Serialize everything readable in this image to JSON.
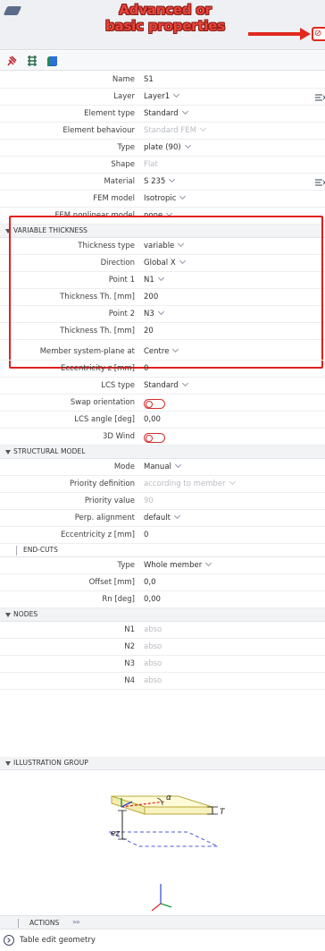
{
  "annotation": {
    "line1": "Advanced or",
    "line2": "basic properties",
    "color": "#e8443a"
  },
  "toolbar": {
    "icons": [
      "pin-icon",
      "layers-icon",
      "cube-icon"
    ]
  },
  "properties": {
    "name": {
      "label": "Name",
      "value": "S1"
    },
    "layer": {
      "label": "Layer",
      "value": "Layer1"
    },
    "element_type": {
      "label": "Element type",
      "value": "Standard"
    },
    "element_behaviour": {
      "label": "Element behaviour",
      "value": "Standard FEM"
    },
    "type": {
      "label": "Type",
      "value": "plate (90)"
    },
    "shape": {
      "label": "Shape",
      "value": "Flat"
    },
    "material": {
      "label": "Material",
      "value": "S 235"
    },
    "fem_model": {
      "label": "FEM model",
      "value": "Isotropic"
    },
    "fem_nonlinear": {
      "label": "FEM nonlinear model",
      "value": "none"
    }
  },
  "variable_thickness": {
    "title": "VARIABLE THICKNESS",
    "thickness_type": {
      "label": "Thickness type",
      "value": "variable"
    },
    "direction": {
      "label": "Direction",
      "value": "Global X"
    },
    "point1": {
      "label": "Point 1",
      "value": "N1"
    },
    "thickness1": {
      "label": "Thickness Th. [mm]",
      "value": "200"
    },
    "point2": {
      "label": "Point 2",
      "value": "N3"
    },
    "thickness2": {
      "label": "Thickness Th. [mm]",
      "value": "20"
    }
  },
  "more": {
    "member_plane": {
      "label": "Member system-plane at",
      "value": "Centre"
    },
    "eccentricity": {
      "label": "Eccentricity z [mm]",
      "value": "0"
    },
    "lcs_type": {
      "label": "LCS type",
      "value": "Standard"
    },
    "swap": {
      "label": "Swap orientation",
      "on": false
    },
    "lcs_angle": {
      "label": "LCS angle [deg]",
      "value": "0,00"
    },
    "wind3d": {
      "label": "3D Wind",
      "on": false
    }
  },
  "structural_model": {
    "title": "STRUCTURAL MODEL",
    "mode": {
      "label": "Mode",
      "value": "Manual"
    },
    "priority_def": {
      "label": "Priority definition",
      "value": "according to member"
    },
    "priority_val": {
      "label": "Priority value",
      "value": "90"
    },
    "perp": {
      "label": "Perp. alignment",
      "value": "default"
    },
    "ecc": {
      "label": "Eccentricity z [mm]",
      "value": "0"
    }
  },
  "end_cuts": {
    "title": "END-CUTS",
    "type": {
      "label": "Type",
      "value": "Whole member"
    },
    "offset": {
      "label": "Offset [mm]",
      "value": "0,0"
    },
    "rn": {
      "label": "Rn [deg]",
      "value": "0,00"
    }
  },
  "nodes": {
    "title": "NODES",
    "n1": {
      "label": "N1",
      "value": "abso"
    },
    "n2": {
      "label": "N2",
      "value": "abso"
    },
    "n3": {
      "label": "N3",
      "value": "abso"
    },
    "n4": {
      "label": "N4",
      "value": "abso"
    }
  },
  "illustration": {
    "title": "ILLUSTRATION GROUP",
    "alpha": "α",
    "t": "T",
    "ez": "ez"
  },
  "actions": {
    "title": "ACTIONS",
    "chevrons": "»»",
    "table_edit": "Table edit geometry"
  },
  "colors": {
    "highlight": "#e0201f",
    "toggle": "#d62d2d"
  }
}
